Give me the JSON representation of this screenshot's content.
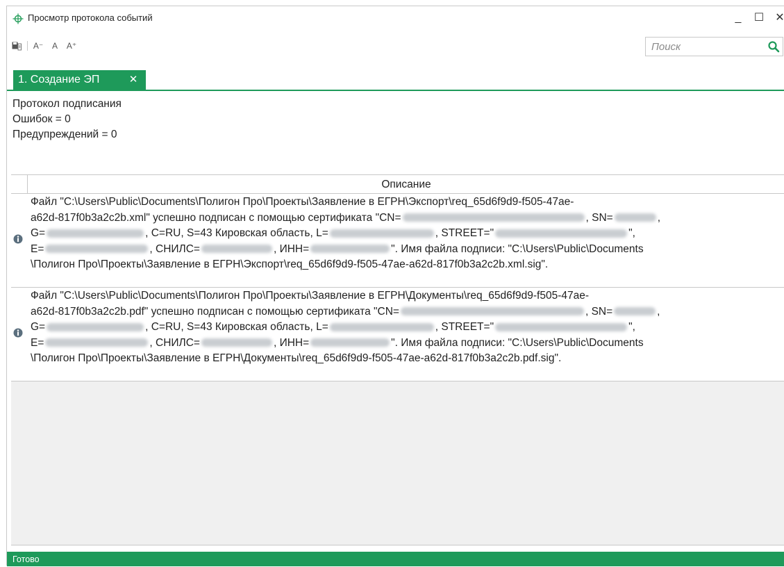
{
  "window": {
    "title": "Просмотр протокола событий",
    "minimize": "_",
    "maximize": "☐",
    "close": "✕"
  },
  "toolbar": {
    "save_icon": "save-icon",
    "font_smaller": "A⁻",
    "font_normal": "A",
    "font_larger": "A⁺"
  },
  "search": {
    "placeholder": "Поиск",
    "value": ""
  },
  "tabs": [
    {
      "label": "1. Создание ЭП",
      "close": "✕"
    }
  ],
  "summary": {
    "title": "Протокол подписания",
    "errors": "Ошибок = 0",
    "warnings": "Предупреждений = 0"
  },
  "grid": {
    "column_header": "Описание",
    "rows": [
      {
        "icon": "info-icon",
        "lines": [
          [
            "Файл \"C:\\Users\\Public\\Documents\\Полигон Про\\Проекты\\Заявление в ЕГРН\\Экспорт\\req_65d6f9d9-f505-47ae-"
          ],
          [
            "a62d-817f0b3a2c2b.xml\" успешно подписан с помощью сертификата \"CN=",
            ", SN=",
            ","
          ],
          [
            "G=",
            ", C=RU, S=43 Кировская область, L=",
            ", STREET=\"",
            "\","
          ],
          [
            "E=",
            ", СНИЛС=",
            ", ИНН=",
            "\". Имя файла подписи: \"C:\\Users\\Public\\Documents"
          ],
          [
            "\\Полигон Про\\Проекты\\Заявление в ЕГРН\\Экспорт\\req_65d6f9d9-f505-47ae-a62d-817f0b3a2c2b.xml.sig\"."
          ]
        ]
      },
      {
        "icon": "info-icon",
        "lines": [
          [
            "Файл \"C:\\Users\\Public\\Documents\\Полигон Про\\Проекты\\Заявление в ЕГРН\\Документы\\req_65d6f9d9-f505-47ae-"
          ],
          [
            "a62d-817f0b3a2c2b.pdf\" успешно подписан с помощью сертификата \"CN=",
            ", SN=",
            ","
          ],
          [
            "G=",
            ", C=RU, S=43 Кировская область, L=",
            ", STREET=\"",
            "\","
          ],
          [
            "E=",
            ", СНИЛС=",
            ", ИНН=",
            "\". Имя файла подписи: \"C:\\Users\\Public\\Documents"
          ],
          [
            "\\Полигон Про\\Проекты\\Заявление в ЕГРН\\Документы\\req_65d6f9d9-f505-47ae-a62d-817f0b3a2c2b.pdf.sig\"."
          ]
        ]
      }
    ]
  },
  "statusbar": {
    "text": "Готово"
  },
  "colors": {
    "accent": "#1e9a5a",
    "border": "#c8c8c8",
    "empty_area": "#f0f0f0"
  }
}
